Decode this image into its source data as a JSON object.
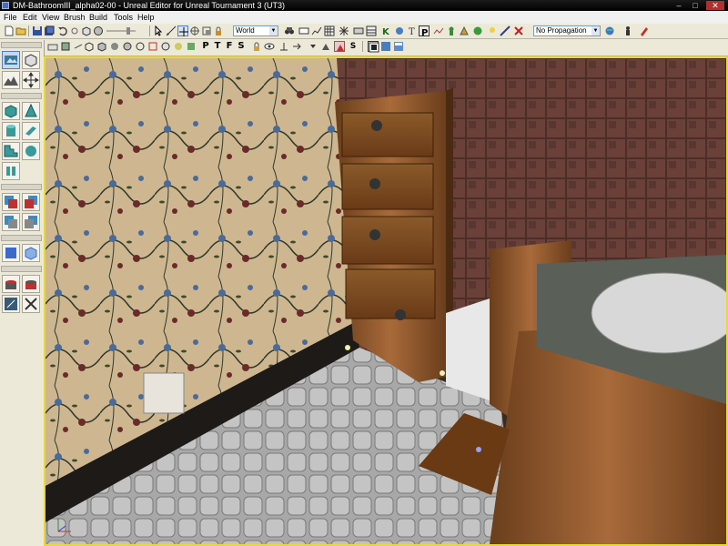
{
  "window": {
    "title": "DM-BathroomIII_alpha02-00 - Unreal Editor for Unreal Tournament 3 (UT3)",
    "controls": [
      "–",
      "□",
      "✕"
    ]
  },
  "menu": [
    "File",
    "Edit",
    "View",
    "Brush",
    "Build",
    "Tools",
    "Help"
  ],
  "toolbar": {
    "coord_system": "World",
    "propagation": "No Propagation",
    "letters": [
      "P",
      "T",
      "F",
      "S"
    ],
    "s_label": "S"
  },
  "icons": {
    "toolbar1": [
      "new-icon",
      "open-icon",
      "save-icon",
      "save-all-icon",
      "undo-icon",
      "redo-icon",
      "pointer-icon",
      "camera-move-icon",
      "scale-icon",
      "world-icon",
      "binoculars-icon",
      "cube-icon",
      "grid-icon",
      "p-icon",
      "k-icon",
      "static-mesh-icon",
      "actor-icon",
      "build-icon",
      "play-icon",
      "light-icon",
      "paths-icon",
      "red-x-icon",
      "globe-icon",
      "settings-icon"
    ],
    "left_panel": [
      "camera-mode-icon",
      "geometry-mode-icon",
      "terrain-icon",
      "translate-icon",
      "cube-brush-icon",
      "cone-brush-icon",
      "cylinder-brush-icon",
      "sheet-brush-icon",
      "stairs-brush-icon",
      "sphere-brush-icon",
      "volumetric-icon",
      "csg-add-icon",
      "csg-subtract-icon",
      "csg-intersect-icon",
      "csg-deintersect-icon",
      "add-volume-icon",
      "add-special-icon",
      "show-selected-icon",
      "hide-selected-icon",
      "select-all-icon",
      "invert-selection-icon"
    ]
  },
  "colors": {
    "viewport_border": "#e8d83a",
    "titlebar": "#000000",
    "toolbar": "#ece9d8"
  }
}
